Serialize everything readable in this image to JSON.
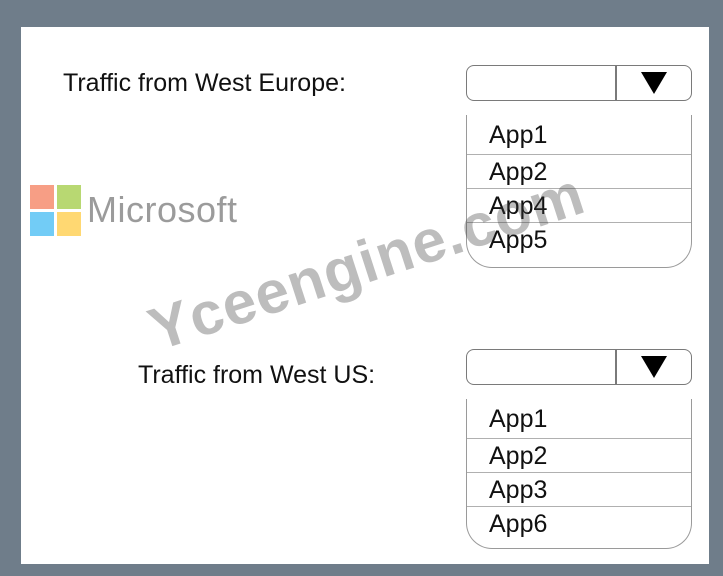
{
  "watermark": {
    "brand": "Microsoft",
    "site": "Yceengine.com"
  },
  "questions": [
    {
      "label": "Traffic from West Europe:",
      "selected": "",
      "options": [
        "App1",
        "App2",
        "App4",
        "App5"
      ]
    },
    {
      "label": "Traffic from West US:",
      "selected": "",
      "options": [
        "App1",
        "App2",
        "App3",
        "App6"
      ]
    }
  ],
  "colors": {
    "frame": "#6f7d8a",
    "panel": "#ffffff",
    "text": "#111111"
  },
  "icons": {
    "dropdown": "triangle-down-icon"
  }
}
